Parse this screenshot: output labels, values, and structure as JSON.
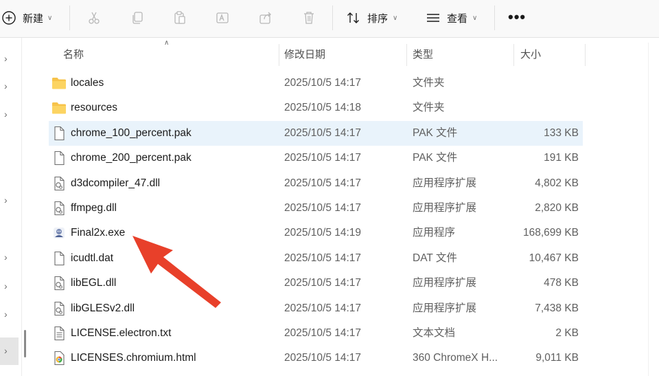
{
  "toolbar": {
    "new_label": "新建",
    "sort_label": "排序",
    "view_label": "查看",
    "more_label": "•••"
  },
  "columns": {
    "name": "名称",
    "date": "修改日期",
    "type": "类型",
    "size": "大小"
  },
  "files": [
    {
      "name": "locales",
      "date": "2025/10/5 14:17",
      "type": "文件夹",
      "size": "",
      "icon": "folder-icon"
    },
    {
      "name": "resources",
      "date": "2025/10/5 14:18",
      "type": "文件夹",
      "size": "",
      "icon": "folder-icon"
    },
    {
      "name": "chrome_100_percent.pak",
      "date": "2025/10/5 14:17",
      "type": "PAK 文件",
      "size": "133 KB",
      "icon": "file-icon"
    },
    {
      "name": "chrome_200_percent.pak",
      "date": "2025/10/5 14:17",
      "type": "PAK 文件",
      "size": "191 KB",
      "icon": "file-icon"
    },
    {
      "name": "d3dcompiler_47.dll",
      "date": "2025/10/5 14:17",
      "type": "应用程序扩展",
      "size": "4,802 KB",
      "icon": "dll-icon"
    },
    {
      "name": "ffmpeg.dll",
      "date": "2025/10/5 14:17",
      "type": "应用程序扩展",
      "size": "2,820 KB",
      "icon": "dll-icon"
    },
    {
      "name": "Final2x.exe",
      "date": "2025/10/5 14:19",
      "type": "应用程序",
      "size": "168,699 KB",
      "icon": "exe-icon"
    },
    {
      "name": "icudtl.dat",
      "date": "2025/10/5 14:17",
      "type": "DAT 文件",
      "size": "10,467 KB",
      "icon": "file-icon"
    },
    {
      "name": "libEGL.dll",
      "date": "2025/10/5 14:17",
      "type": "应用程序扩展",
      "size": "478 KB",
      "icon": "dll-icon"
    },
    {
      "name": "libGLESv2.dll",
      "date": "2025/10/5 14:17",
      "type": "应用程序扩展",
      "size": "7,438 KB",
      "icon": "dll-icon"
    },
    {
      "name": "LICENSE.electron.txt",
      "date": "2025/10/5 14:17",
      "type": "文本文档",
      "size": "2 KB",
      "icon": "text-file-icon"
    },
    {
      "name": "LICENSES.chromium.html",
      "date": "2025/10/5 14:17",
      "type": "360 ChromeX H...",
      "size": "9,011 KB",
      "icon": "browser-html-icon"
    }
  ],
  "highlighted_row": 2,
  "colors": {
    "accent": "#0067c0",
    "arrow": "#e8402a",
    "row_highlight": "#e9f3fb",
    "folder": "#f7c34a"
  }
}
